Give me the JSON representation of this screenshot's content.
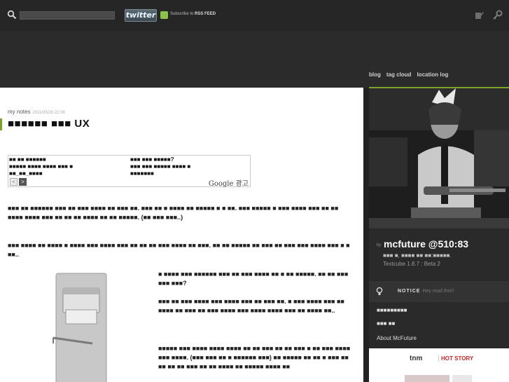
{
  "topbar": {
    "search_placeholder": "",
    "twitter_label": "twitter",
    "rss_text_prefix": "Subscribe to ",
    "rss_text_bold": "RSS FEED",
    "icons": [
      "search-icon",
      "rss-icon",
      "write-icon",
      "admin-key-icon"
    ]
  },
  "nav": {
    "items": [
      "blog",
      "tag cloud",
      "location log"
    ]
  },
  "post": {
    "category": "my notes",
    "date": "2011/05/26 22:08",
    "title": "■■■■■■ ■■■ UX",
    "ad": {
      "left_lines": [
        "■■ ■■ ■■■■■■",
        "■■■■■ ■■■■ ■■■■ ■■■ ■",
        "■■_■■_■■■■"
      ],
      "right_lines": [
        "■■■ ■■■ ■■■■■?",
        "■■■ ■■■ ■■■■■ ■■■■ ■",
        "■■■■■■■"
      ],
      "prev": "<",
      "next": ">",
      "logo_text": "Google 광고"
    },
    "paragraphs": [
      "■■■ ■■ ■■■■■■ ■■■ ■■ ■■■ ■■■■ ■■ ■■■ ■■. ■■■ ■■ ■ ■■■■ ■■ ■■■■■ ■ ■ ■■. ■■■ ■■■■■ ■ ■■■ ■■■■ ■■■ ■■ ■■ ■■■■ ■■■■ ■■■ ■■ ■■ ■■ ■■■■ ■■ ■■ ■■■■■. (■■ ■■■ ■■■..)",
      "■■■ ■■■■ ■■ ■■■■ ■ ■■■■ ■■■ ■■■■ ■■■ ■■ ■■ ■■ ■■■ ■■■■ ■■ ■■■. ■■ ■■ ■■■■■ ■■ ■■■ ■■ ■■■ ■■■ ■■■■ ■■■ ■ ■ ■■..",
      "■ ■■■■ ■■■ ■■■■■■ ■■■ ■■ ■■■ ■■■■ ■■ ■ ■■ ■■■■■. ■■ ■■ ■■■ ■■■ ■■■?",
      "■■■ ■■ ■■■ ■■■■ ■■■ ■■■■ ■■■ ■■ ■■■ ■■. ■ ■■■ ■■■■ ■■■ ■■ ■■■■ ■■ ■■■ ■■ ■■■ ■■■■ ■■■ ■■■■ ■■■■ ■■■ ■■ ■■■■ ■■..",
      "■■■■■ ■■■ ■■■■ ■■■■ ■■■■ ■■ ■■ ■■■ ■■ ■■ ■■■ ■ ■■ ■■■ ■■■■ ■■■ ■■■■. (■■■ ■■■ ■■ ■ ■■■■■■ ■■■) ■■ ■■■■■ ■■ ■■ ■ ■■■ ■■ ■■ ■■ ■■ ■■■ ■■ ■■ ■■■■ ■■ ■■■■■ ■■■■ ■■"
    ]
  },
  "sidebar": {
    "by_label": "by",
    "blog_name": "mcfuture @510:83",
    "description": "■■■ ■, ■■■■ ■■ ■■:■■■■■.",
    "version": "Textcube 1.8.7 : Beta 2",
    "notice_label": "NOTICE",
    "notice_hint": "Hey read this!!",
    "items": [
      "■■■■■■■■■",
      "■■■ ■■",
      "About McFuture"
    ],
    "widget_logo": "tnm",
    "widget_hot": "HOT STORY"
  },
  "colors": {
    "accent": "#7aa32a",
    "background": "#222222",
    "content_bg": "#ffffff"
  }
}
